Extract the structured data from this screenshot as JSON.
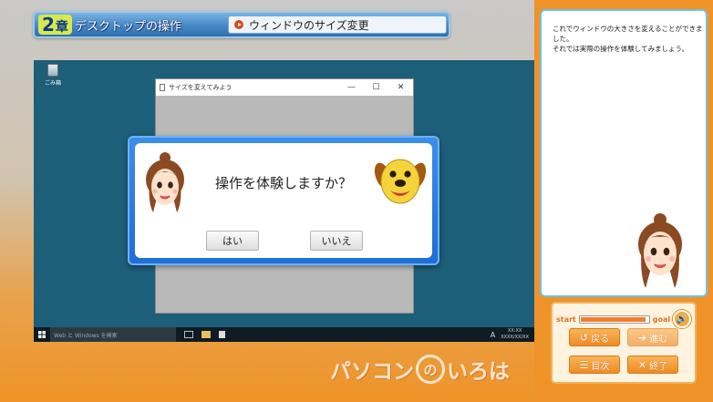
{
  "header": {
    "chapter_number": "2",
    "chapter_suffix": "章",
    "chapter_title": "デスクトップの操作",
    "section_title": "ウィンドウのサイズ変更"
  },
  "desktop": {
    "recycle_bin_label": "ごみ箱",
    "window_title": "サイズを変えてみよう",
    "minimize_glyph": "—",
    "maximize_glyph": "☐",
    "close_glyph": "✕",
    "taskbar_search": "Web と Windows を検索",
    "ime_indicator": "A",
    "clock_time": "XX:XX",
    "clock_date": "XXXX/XX/XX"
  },
  "dialog": {
    "question": "操作を体験しますか？",
    "yes_label": "はい",
    "no_label": "いいえ"
  },
  "logo": {
    "text_left": "パソコン",
    "text_circle": "の",
    "text_right": "いろは"
  },
  "sidebar": {
    "message_line1": "これでウィンドウの大きさを変えることができました。",
    "message_line2": "それでは実際の操作を体験してみましょう。",
    "progress_start": "start",
    "progress_goal": "goal",
    "progress_fraction": 0.94,
    "sound_icon": "speaker-icon",
    "back_label": "戻る",
    "next_label": "進む",
    "toc_label": "目次",
    "quit_label": "終了"
  }
}
